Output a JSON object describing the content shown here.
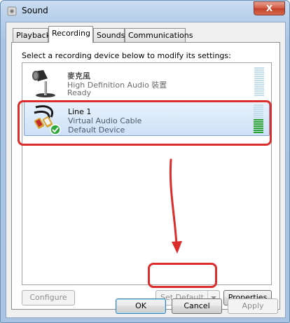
{
  "window": {
    "title": "Sound",
    "close_label": "X"
  },
  "tabs": [
    {
      "label": "Playback"
    },
    {
      "label": "Recording"
    },
    {
      "label": "Sounds"
    },
    {
      "label": "Communications"
    }
  ],
  "instruction": "Select a recording device below to modify its settings:",
  "devices": [
    {
      "name": "麥克風",
      "description": "High Definition Audio 裝置",
      "status": "Ready",
      "icon": "microphone-icon",
      "level_segments_on": 0
    },
    {
      "name": "Line 1",
      "description": "Virtual Audio Cable",
      "status": "Default Device",
      "icon": "audio-cable-icon",
      "level_segments_on": 7
    }
  ],
  "buttons": {
    "configure": "Configure",
    "set_default": "Set Default",
    "properties": "Properties",
    "ok": "OK",
    "cancel": "Cancel",
    "apply": "Apply"
  },
  "colors": {
    "annotation": "#dc2d2d",
    "selection": "#cde1f7",
    "meter_on": "#27a12c"
  }
}
